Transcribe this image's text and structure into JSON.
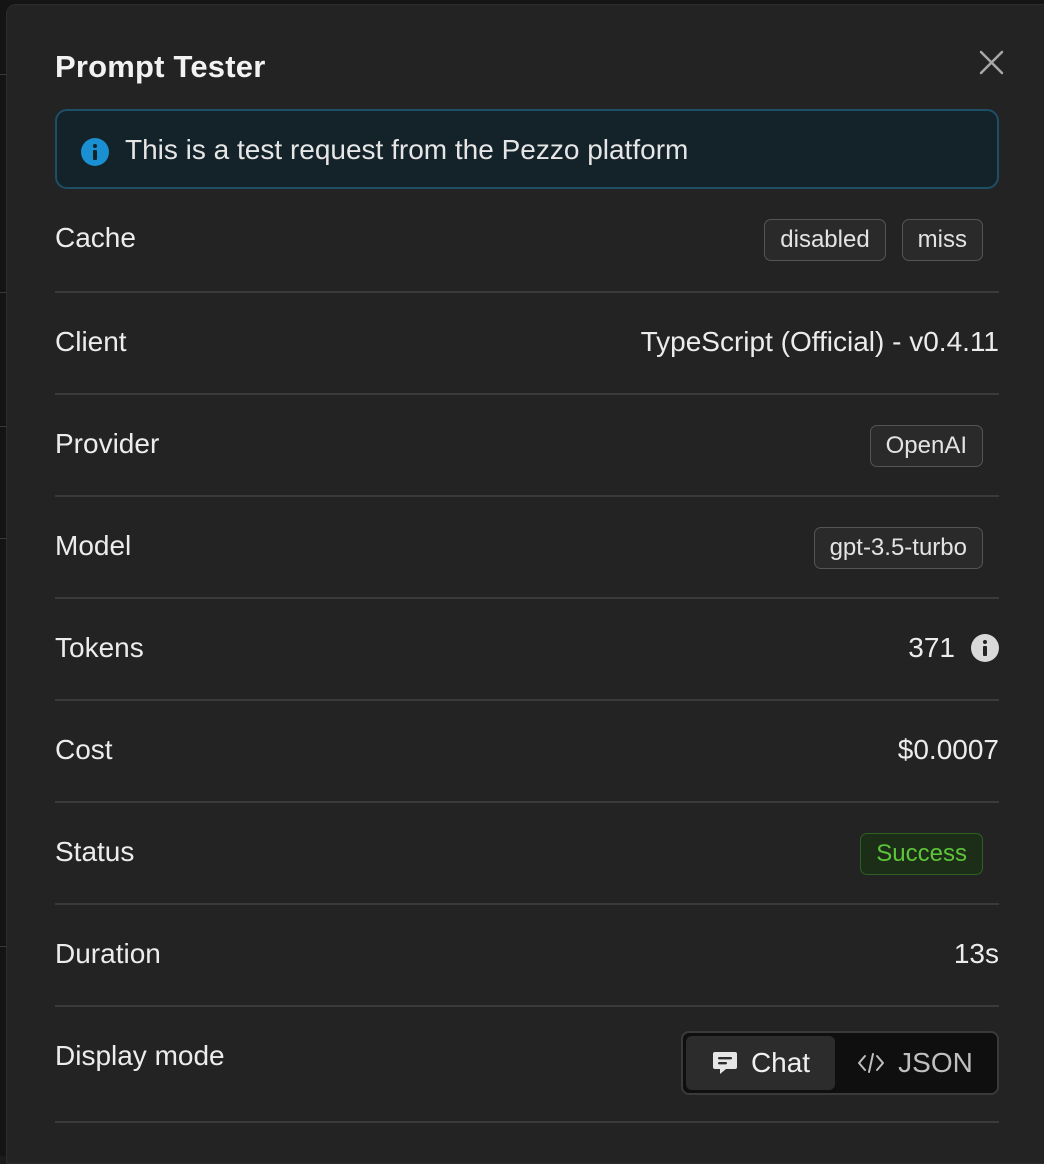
{
  "modal": {
    "title": "Prompt Tester",
    "alert": {
      "icon": "info-icon",
      "text": "This is a test request from the Pezzo platform",
      "color": "#1a8fd1"
    }
  },
  "rows": {
    "cache": {
      "label": "Cache",
      "badges": [
        "disabled",
        "miss"
      ]
    },
    "client": {
      "label": "Client",
      "value": "TypeScript (Official) - v0.4.11"
    },
    "provider": {
      "label": "Provider",
      "badge": "OpenAI"
    },
    "model": {
      "label": "Model",
      "badge": "gpt-3.5-turbo"
    },
    "tokens": {
      "label": "Tokens",
      "value": "371",
      "icon": "info-icon"
    },
    "cost": {
      "label": "Cost",
      "value": "$0.0007"
    },
    "status": {
      "label": "Status",
      "badge": "Success",
      "color": "#5cc53a"
    },
    "duration": {
      "label": "Duration",
      "value": "13s"
    },
    "display_mode": {
      "label": "Display mode",
      "options": [
        {
          "label": "Chat",
          "icon": "chat-icon",
          "selected": true
        },
        {
          "label": "JSON",
          "icon": "code-icon",
          "selected": false
        }
      ]
    }
  }
}
